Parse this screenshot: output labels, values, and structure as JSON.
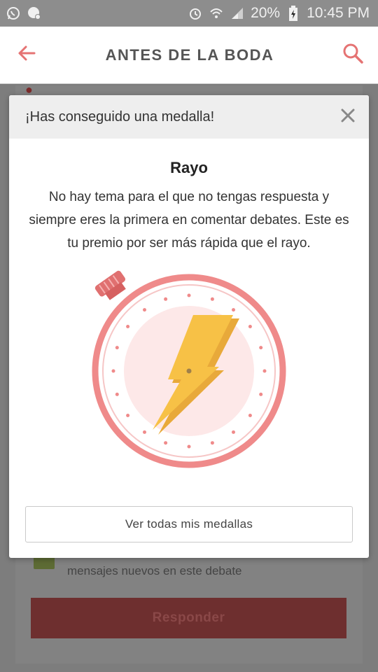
{
  "status_bar": {
    "battery": "20%",
    "time": "10:45 PM",
    "icons": [
      "whatsapp-icon",
      "messenger-icon",
      "alarm-icon",
      "wifi-icon",
      "signal-icon",
      "battery-icon"
    ]
  },
  "app_bar": {
    "title": "ANTES DE LA BODA",
    "back_icon": "arrow-left-icon",
    "search_icon": "search-icon",
    "accent_color": "#e57373"
  },
  "background": {
    "notify_text": "mensajes nuevos en este debate",
    "reply_label": "Responder"
  },
  "modal": {
    "header_title": "¡Has conseguido una medalla!",
    "close_icon": "close-icon",
    "medal_name": "Rayo",
    "medal_description": "No hay tema para el que no tengas respuesta y siempre eres la primera en comentar debates. Este es tu premio por ser más rápida que el rayo.",
    "medal_icon": "stopwatch-lightning-icon",
    "view_all_label": "Ver todas mis medallas",
    "colors": {
      "ring": "#ef8a8a",
      "face": "#fde8e8",
      "bolt": "#f7c146"
    }
  }
}
